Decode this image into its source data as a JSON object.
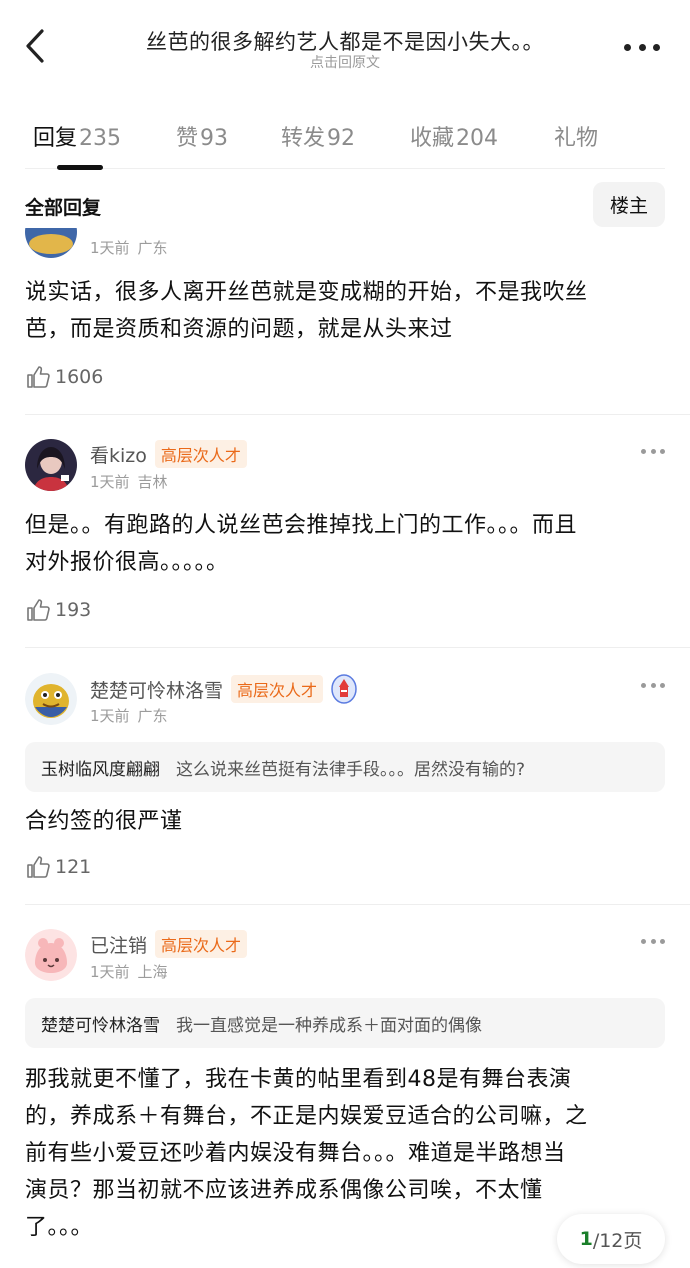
{
  "header": {
    "title": "丝芭的很多解约艺人都是不是因小失大。。",
    "subtitle": "点击回原文"
  },
  "tabs": [
    {
      "label": "回复",
      "count": "235"
    },
    {
      "label": "赞",
      "count": "93"
    },
    {
      "label": "转发",
      "count": "92"
    },
    {
      "label": "收藏",
      "count": "204"
    },
    {
      "label": "礼物",
      "count": ""
    }
  ],
  "filter": {
    "all_label": "全部回复",
    "op_label": "楼主"
  },
  "posts": [
    {
      "time": "1天前",
      "location": "广东",
      "lines": [
        "说实话，很多人离开丝芭就是变成糊的开始，不是我吹丝",
        "芭，而是资质和资源的问题，就是从头来过"
      ],
      "likes": "1606"
    },
    {
      "user": "看kizo",
      "badge": "高层次人才",
      "time": "1天前",
      "location": "吉林",
      "lines": [
        "但是。。有跑路的人说丝芭会推掉找上门的工作。。。而且",
        "对外报价很高。。。。。"
      ],
      "likes": "193"
    },
    {
      "user": "楚楚可怜林洛雪",
      "badge": "高层次人才",
      "time": "1天前",
      "location": "广东",
      "quote": {
        "name": "玉树临风度翩翩",
        "text": "这么说来丝芭挺有法律手段。。。居然没有输的?"
      },
      "lines": [
        "合约签的很严谨"
      ],
      "likes": "121"
    },
    {
      "user": "已注销",
      "badge": "高层次人才",
      "time": "1天前",
      "location": "上海",
      "quote": {
        "name": "楚楚可怜林洛雪",
        "text": "我一直感觉是一种养成系＋面对面的偶像"
      },
      "lines": [
        "那我就更不懂了，我在卡黄的帖里看到48是有舞台表演",
        "的，养成系＋有舞台，不正是内娱爱豆适合的公司嘛，之",
        "前有些小爱豆还吵着内娱没有舞台。。。难道是半路想当",
        "演员？那当初就不应该进养成系偶像公司唉，不太懂",
        "了。。。"
      ]
    }
  ],
  "pager": {
    "current": "1",
    "total": "/12页"
  },
  "colors": {
    "badge_text": "#ea6a1a",
    "badge_bg": "#fdf0e4",
    "pager_current": "#1a7f2a"
  }
}
